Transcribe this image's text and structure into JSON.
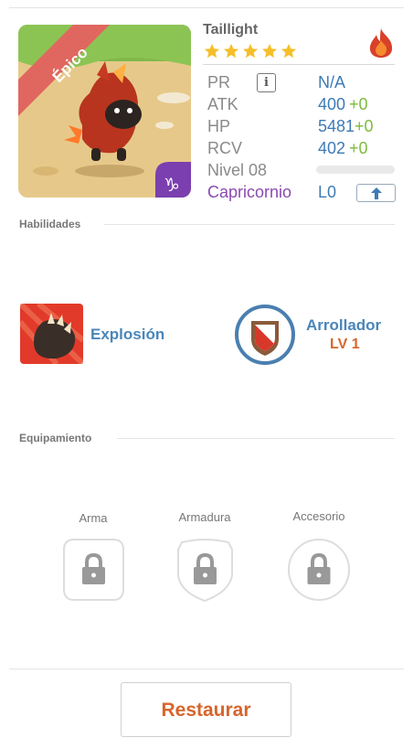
{
  "pet": {
    "name": "Taillight",
    "rarity": "Épico",
    "stars": 5,
    "element_icon": "fire-icon",
    "class_icon": "capricorn-icon"
  },
  "stats": {
    "pr_label": "PR",
    "pr_value": "N/A",
    "atk_label": "ATK",
    "atk_value": "400",
    "atk_bonus": "+0",
    "hp_label": "HP",
    "hp_value": "5481",
    "hp_bonus": "+0",
    "rcv_label": "RCV",
    "rcv_value": "402",
    "rcv_bonus": "+0",
    "level_label": "Nivel 08",
    "level_progress": 0.0,
    "sign_label": "Capricornio",
    "sign_value": "L0"
  },
  "skills_section": {
    "title": "Habilidades"
  },
  "skills": [
    {
      "name": "Explosión"
    },
    {
      "name": "Arrollador",
      "level": "LV 1"
    }
  ],
  "equipment_section": {
    "title": "Equipamiento"
  },
  "equipment": [
    {
      "label": "Arma"
    },
    {
      "label": "Armadura"
    },
    {
      "label": "Accesorio"
    }
  ],
  "footer": {
    "restore_label": "Restaurar"
  },
  "colors": {
    "accent_blue": "#3d7bb6",
    "accent_orange": "#d7652b",
    "green": "#7dbb3c",
    "purple": "#8a4ab0",
    "ribbon": "#e0675f"
  }
}
